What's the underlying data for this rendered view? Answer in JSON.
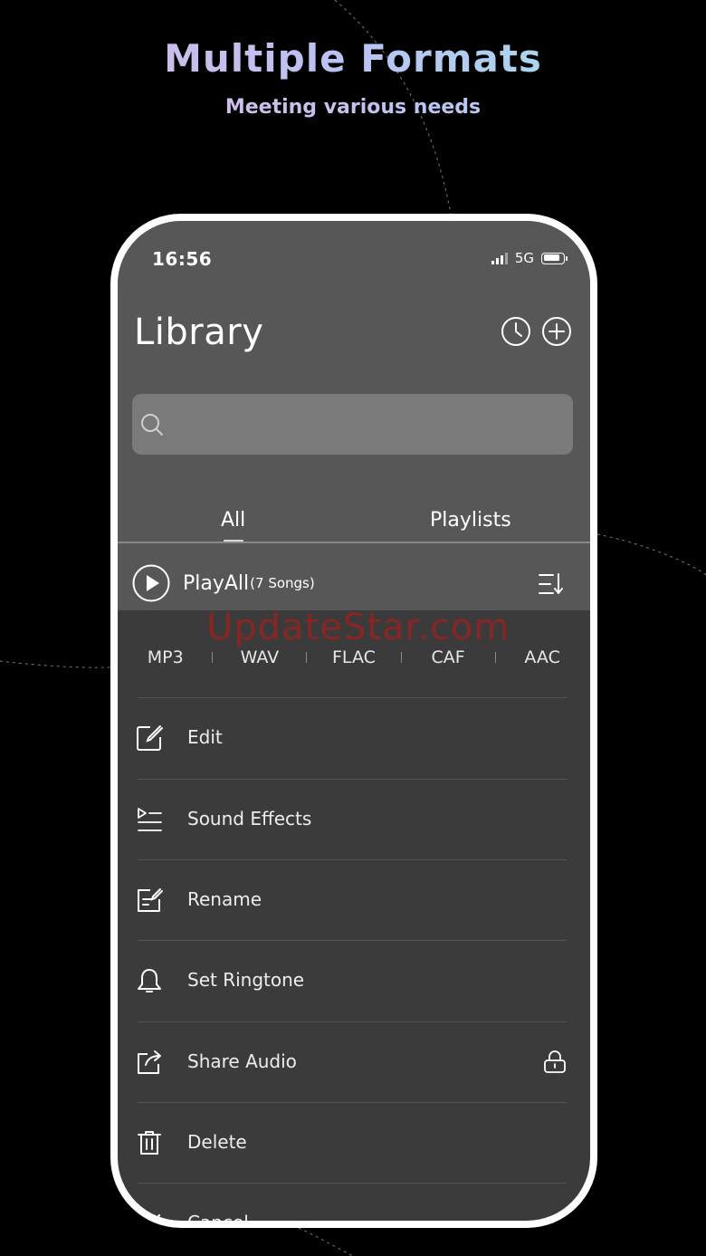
{
  "headline": "Multiple Formats",
  "subheadline": "Meeting various needs",
  "status_bar": {
    "time": "16:56",
    "network": "5G",
    "battery_level": 0.85
  },
  "library": {
    "title": "Library",
    "history_icon": "clock-icon",
    "add_icon": "plus-circle-icon",
    "search": {
      "placeholder": "",
      "value": ""
    },
    "tabs": [
      {
        "label": "All",
        "active": true
      },
      {
        "label": "Playlists",
        "active": false
      }
    ],
    "play_all": {
      "label": "PlayAll",
      "count": "(7 Songs)"
    }
  },
  "formats": [
    "MP3",
    "WAV",
    "FLAC",
    "CAF",
    "AAC"
  ],
  "menu": [
    {
      "label": "Edit",
      "icon": "edit-icon",
      "locked": false
    },
    {
      "label": "Sound Effects",
      "icon": "sound-effects-icon",
      "locked": false
    },
    {
      "label": "Rename",
      "icon": "rename-icon",
      "locked": false
    },
    {
      "label": "Set Ringtone",
      "icon": "bell-icon",
      "locked": false
    },
    {
      "label": "Share Audio",
      "icon": "share-icon",
      "locked": true
    },
    {
      "label": "Delete",
      "icon": "trash-icon",
      "locked": false
    },
    {
      "label": "Cancel",
      "icon": "check-icon",
      "locked": false
    }
  ],
  "watermark": "UpdateStar.com",
  "colors": {
    "background": "#000000",
    "screen": "#3b3b3b",
    "header": "#575757",
    "watermark": "#c81414"
  }
}
